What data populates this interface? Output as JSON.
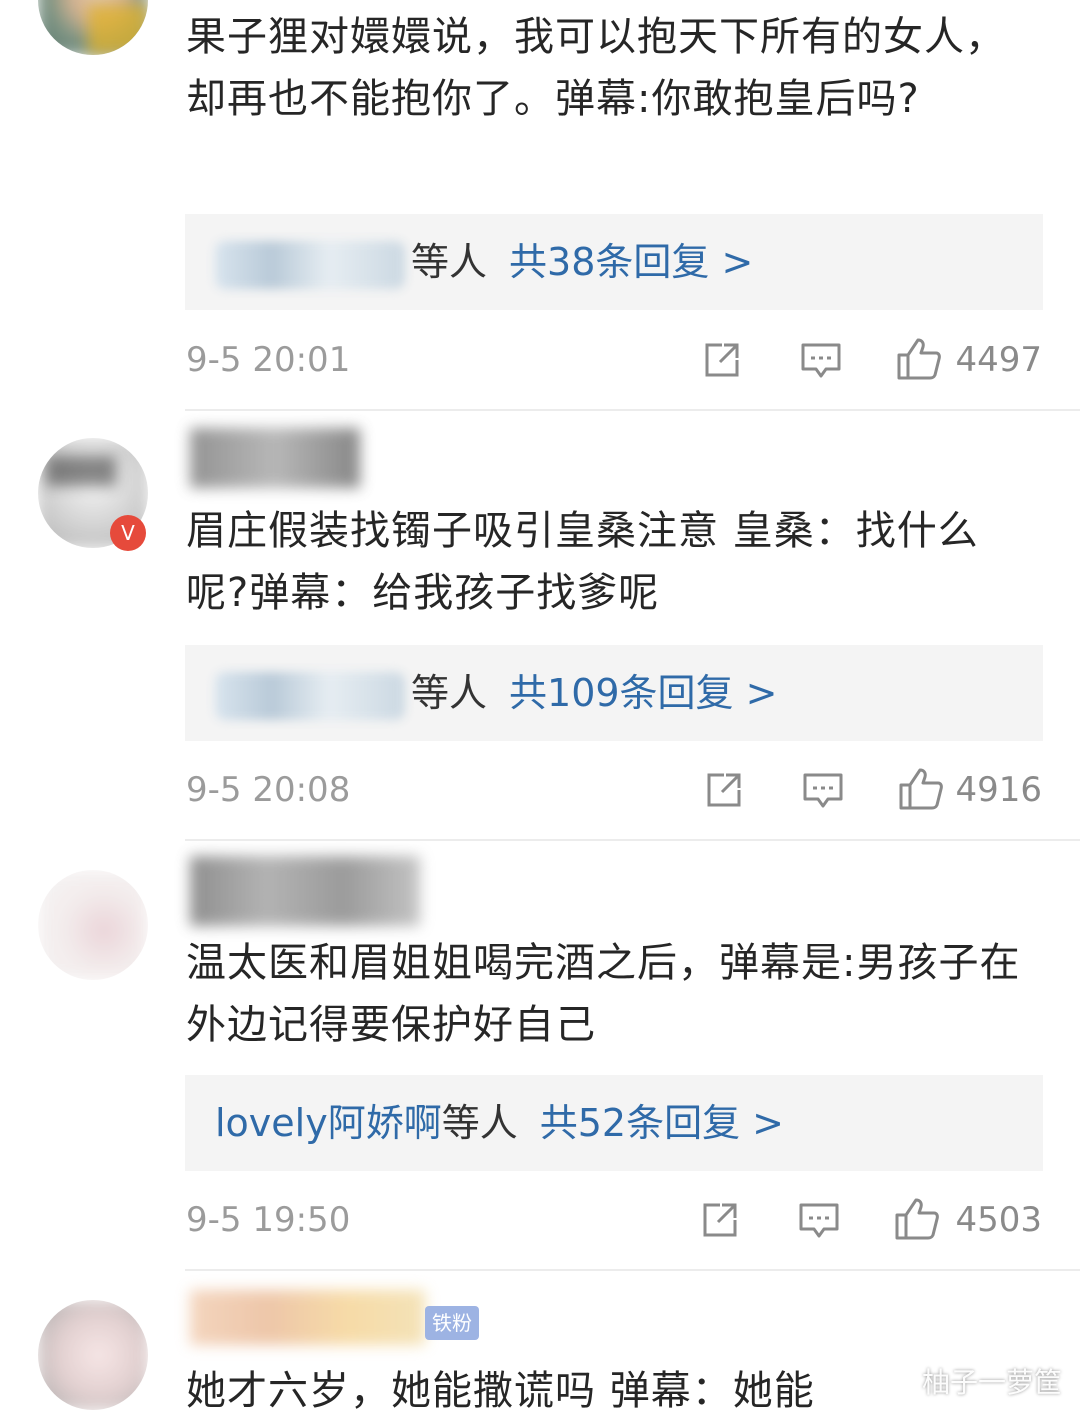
{
  "comments": [
    {
      "text": "果子狸对嬛嬛说，我可以抱天下所有的女人，却再也不能抱你了。弹幕:你敢抱皇后吗?",
      "reply_people": "",
      "reply_suffix": "等人",
      "reply_count": "共38条回复 >",
      "time": "9-5 20:01",
      "likes": "4497"
    },
    {
      "text": "眉庄假装找镯子吸引皇桑注意 皇桑：找什么呢?弹幕：给我孩子找爹呢",
      "reply_people": "",
      "reply_suffix": "等人",
      "reply_count": "共109条回复 >",
      "time": "9-5 20:08",
      "likes": "4916"
    },
    {
      "text": "温太医和眉姐姐喝完酒之后，弹幕是:男孩子在外边记得要保护好自己",
      "reply_people": "lovely阿娇啊",
      "reply_suffix": "等人",
      "reply_count": "共52条回复 >",
      "time": "9-5 19:50",
      "likes": "4503"
    },
    {
      "text": "她才六岁，她能撒谎吗 弹幕：她能"
    }
  ],
  "badges": {
    "verified": "V",
    "fan": "铁粉"
  },
  "icons": {
    "share": "share-icon",
    "comment": "comment-icon",
    "like": "thumbs-up-icon"
  },
  "watermark": "柚子一萝筐"
}
